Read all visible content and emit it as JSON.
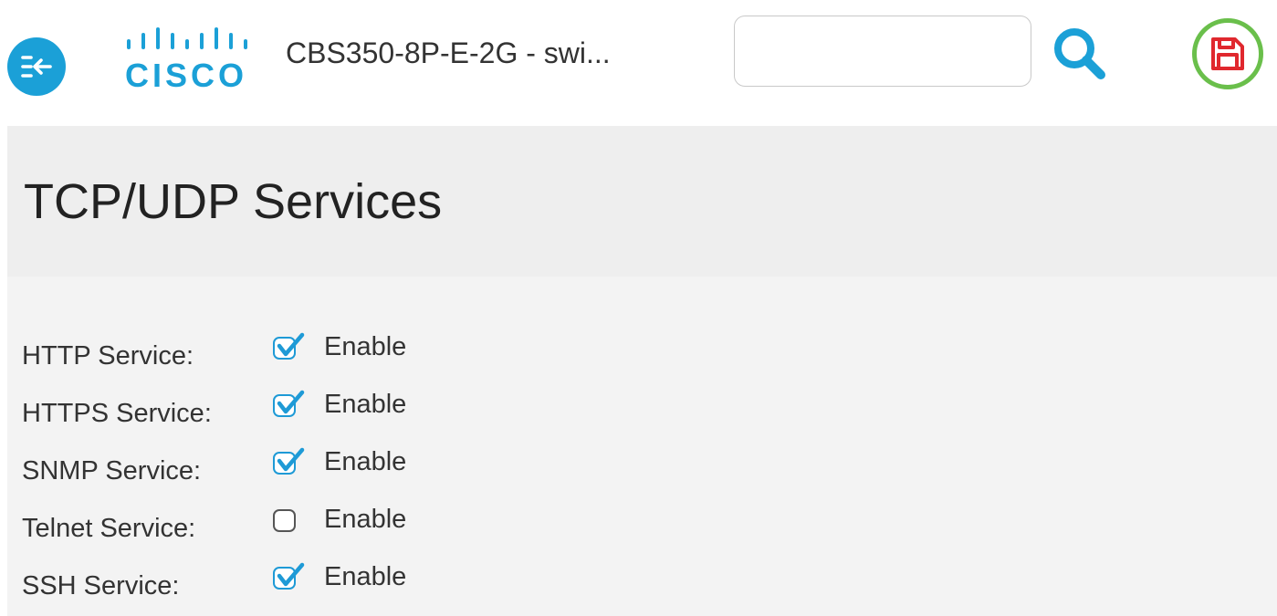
{
  "header": {
    "device_name": "CBS350-8P-E-2G - swi...",
    "logo_text": "cisco",
    "search": {
      "value": "",
      "placeholder": ""
    },
    "icons": {
      "nav_toggle": "collapse-menu-icon",
      "search": "search-icon",
      "save": "save-icon"
    },
    "colors": {
      "brand_blue": "#1ba0d7",
      "save_ring": "#6abf4b",
      "save_icon": "#e0282e"
    }
  },
  "page": {
    "title": "TCP/UDP Services"
  },
  "services": [
    {
      "label": "HTTP Service:",
      "checkbox_label": "Enable",
      "checked": true
    },
    {
      "label": "HTTPS Service:",
      "checkbox_label": "Enable",
      "checked": true
    },
    {
      "label": "SNMP Service:",
      "checkbox_label": "Enable",
      "checked": true
    },
    {
      "label": "Telnet Service:",
      "checkbox_label": "Enable",
      "checked": false
    },
    {
      "label": "SSH Service:",
      "checkbox_label": "Enable",
      "checked": true
    }
  ]
}
